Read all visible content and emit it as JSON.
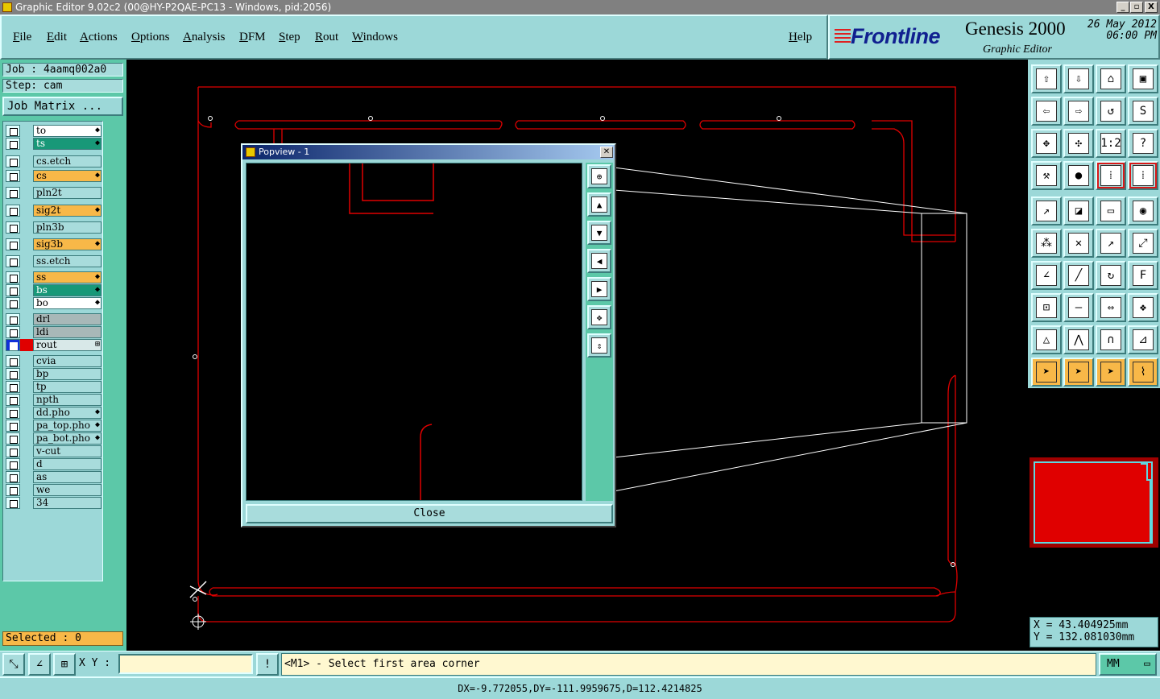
{
  "window": {
    "title": "Graphic Editor 9.02c2 (00@HY-P2QAE-PC13 - Windows, pid:2056)",
    "min": "_",
    "max": "▫",
    "close": "X"
  },
  "menu": [
    "File",
    "Edit",
    "Actions",
    "Options",
    "Analysis",
    "DFM",
    "Step",
    "Rout",
    "Windows"
  ],
  "help_label": "Help",
  "brand": {
    "logo": "Frontline",
    "product": "Genesis 2000",
    "subtitle": "Graphic Editor",
    "date": "26 May 2012",
    "time": "06:00 PM"
  },
  "job": {
    "job_line": "Job : 4aamq002a0",
    "step_line": "Step: cam",
    "matrix_button": "Job Matrix ..."
  },
  "layers": [
    {
      "name": "to",
      "style": "white",
      "marker": "◆"
    },
    {
      "name": "ts",
      "style": "green",
      "marker": "◆"
    },
    {
      "name": "cs.etch",
      "style": "cyan",
      "marker": ""
    },
    {
      "name": "cs",
      "style": "orange",
      "marker": "◆"
    },
    {
      "name": "pln2t",
      "style": "cyan",
      "marker": ""
    },
    {
      "name": "sig2t",
      "style": "orange",
      "marker": "◆"
    },
    {
      "name": "pln3b",
      "style": "cyan",
      "marker": ""
    },
    {
      "name": "sig3b",
      "style": "orange",
      "marker": "◆"
    },
    {
      "name": "ss.etch",
      "style": "cyan",
      "marker": ""
    },
    {
      "name": "ss",
      "style": "orange",
      "marker": "◆"
    },
    {
      "name": "bs",
      "style": "green",
      "marker": "◆"
    },
    {
      "name": "bo",
      "style": "white",
      "marker": "◆"
    },
    {
      "name": "drl",
      "style": "gray",
      "marker": ""
    },
    {
      "name": "ldi",
      "style": "gray",
      "marker": ""
    },
    {
      "name": "rout",
      "style": "light",
      "marker": "⊞",
      "active": true
    },
    {
      "name": "cvia",
      "style": "cyan",
      "marker": ""
    },
    {
      "name": "bp",
      "style": "cyan",
      "marker": ""
    },
    {
      "name": "tp",
      "style": "cyan",
      "marker": ""
    },
    {
      "name": "npth",
      "style": "cyan",
      "marker": ""
    },
    {
      "name": "dd.pho",
      "style": "cyan",
      "marker": "◆"
    },
    {
      "name": "pa_top.pho",
      "style": "cyan",
      "marker": "◆"
    },
    {
      "name": "pa_bot.pho",
      "style": "cyan",
      "marker": "◆"
    },
    {
      "name": "v-cut",
      "style": "cyan",
      "marker": ""
    },
    {
      "name": "d",
      "style": "cyan",
      "marker": ""
    },
    {
      "name": "as",
      "style": "cyan",
      "marker": ""
    },
    {
      "name": "we",
      "style": "cyan",
      "marker": ""
    },
    {
      "name": "34",
      "style": "cyan",
      "marker": ""
    }
  ],
  "selected": "Selected : 0",
  "popview": {
    "title": "Popview - 1",
    "close_label": "Close"
  },
  "toolbar_icons": [
    [
      "zoom-home-icon",
      "zoom-back-icon",
      "zoom-home2-icon",
      "zoom-window-icon"
    ],
    [
      "pan-left-icon",
      "pan-right-icon",
      "zoom-undo-icon",
      "redraw-icon"
    ],
    [
      "zoom-fit-icon",
      "zoom-profile-icon",
      "zoom-1-2-icon",
      "help-icon"
    ],
    [
      "tools-icon",
      "measure-pad-icon",
      "layers-on-icon",
      "layers-off-icon"
    ],
    [
      "select-feature-icon",
      "select-net-icon",
      "ruler-icon",
      "select-pad-icon"
    ],
    [
      "add-pad-icon",
      "delete-pad-icon",
      "move-pad-icon",
      "copy-pad-icon"
    ],
    [
      "add-line-icon",
      "edit-line-icon",
      "arc-icon",
      "text-edit-icon"
    ],
    [
      "snap-icon",
      "break-icon",
      "resize-icon",
      "fill-icon"
    ],
    [
      "shape-triangle-icon",
      "shape-arch-icon",
      "shape-bridge-icon",
      "shape-cross-icon"
    ],
    [
      "select-arrow-icon",
      "select-box-icon",
      "select-diag-icon",
      "route-icon"
    ]
  ],
  "coords": {
    "x": "X =  43.404925mm",
    "y": "Y = 132.081030mm"
  },
  "bottom": {
    "xy_label": "X Y :",
    "xy_value": "",
    "prompt": "<M1> - Select first area corner",
    "units": "MM"
  },
  "status": "DX=-9.772055,DY=-111.9959675,D=112.4214825",
  "colors": {
    "panel": "#9cd8d8",
    "accent_green": "#5cc8a8",
    "rout_red": "#e00000",
    "canvas": "#000000"
  }
}
